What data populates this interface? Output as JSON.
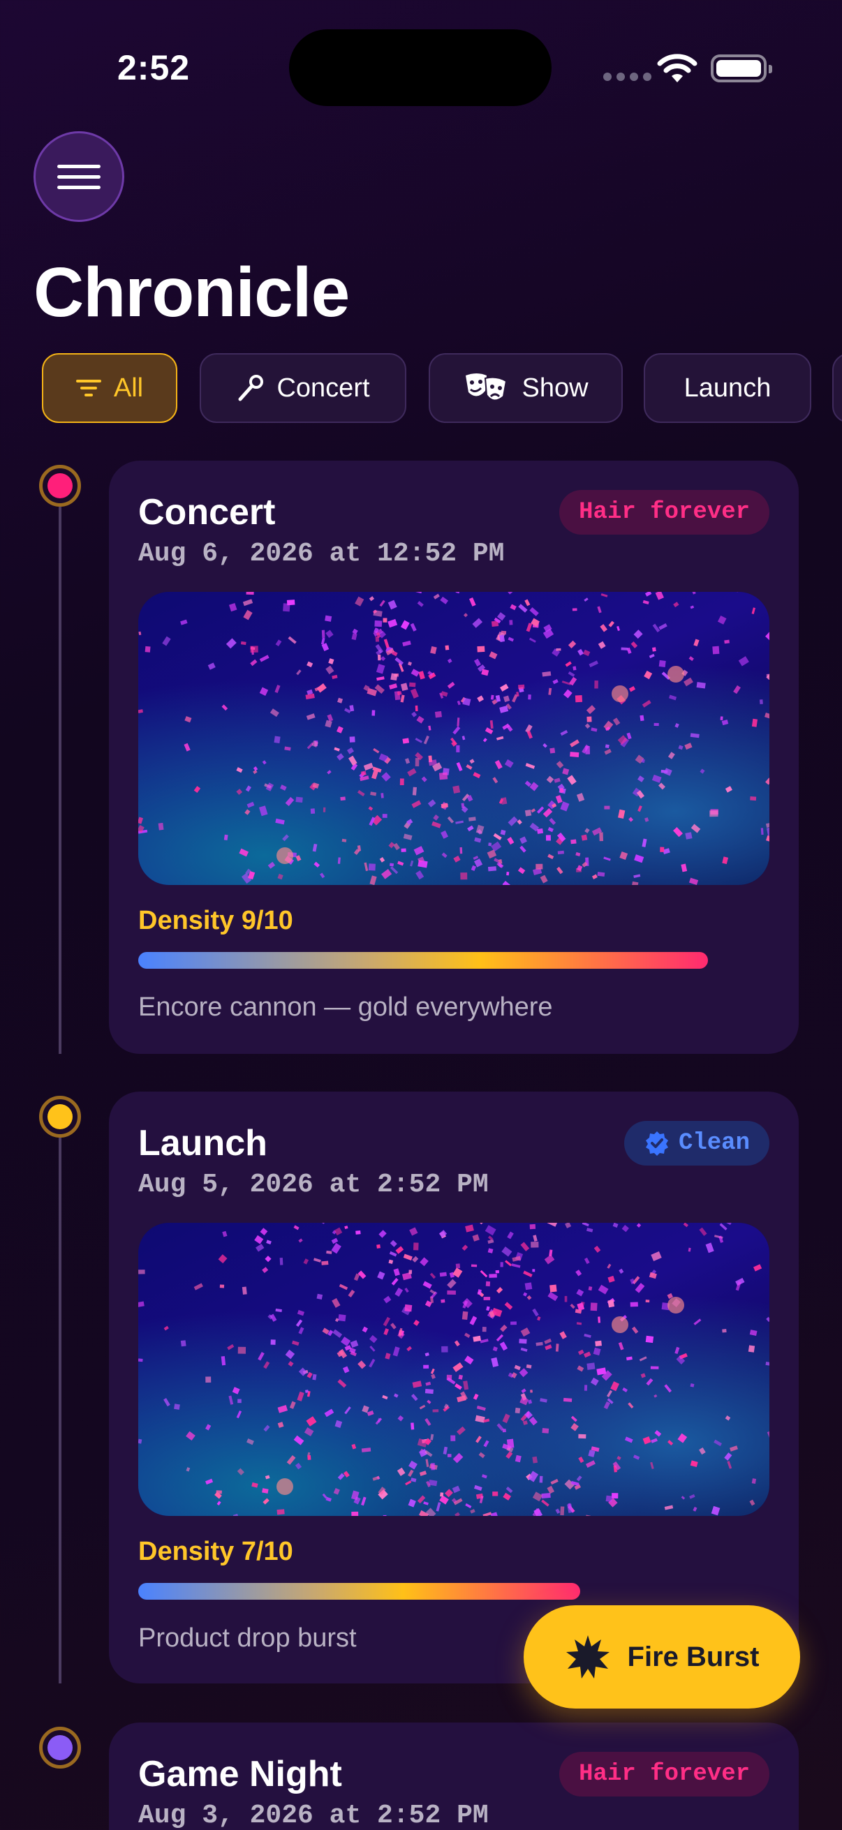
{
  "status_bar": {
    "time": "2:52"
  },
  "header": {
    "title": "Chronicle"
  },
  "filters": [
    {
      "label": "All",
      "icon": "filter-lines-icon",
      "active": true
    },
    {
      "label": "Concert",
      "icon": "microphone-icon",
      "active": false
    },
    {
      "label": "Show",
      "icon": "theater-masks-icon",
      "active": false
    },
    {
      "label": "Launch",
      "icon": "",
      "active": false
    }
  ],
  "entries": [
    {
      "title": "Concert",
      "date": "Aug 6, 2026 at 12:52 PM",
      "badge": "Hair forever",
      "badge_type": "hair",
      "density_label": "Density 9/10",
      "density": 9,
      "note": "Encore cannon — gold everywhere",
      "dot_color": "#ff1f7a"
    },
    {
      "title": "Launch",
      "date": "Aug 5, 2026 at 2:52 PM",
      "badge": "Clean",
      "badge_type": "clean",
      "badge_icon": "verified-badge-icon",
      "density_label": "Density 7/10",
      "density": 7,
      "note": "Product drop burst",
      "dot_color": "#ffc21a"
    },
    {
      "title": "Game Night",
      "date": "Aug 3, 2026 at 2:52 PM",
      "badge": "Hair forever",
      "badge_type": "hair",
      "dot_color": "#8b5cf6"
    }
  ],
  "fab": {
    "label": "Fire Burst",
    "icon": "burst-star-icon"
  },
  "colors": {
    "accent": "#ffc21a",
    "hot_pink": "#ff1f7a",
    "card_bg": "#24103f",
    "clean_blue": "#5a8dff"
  }
}
